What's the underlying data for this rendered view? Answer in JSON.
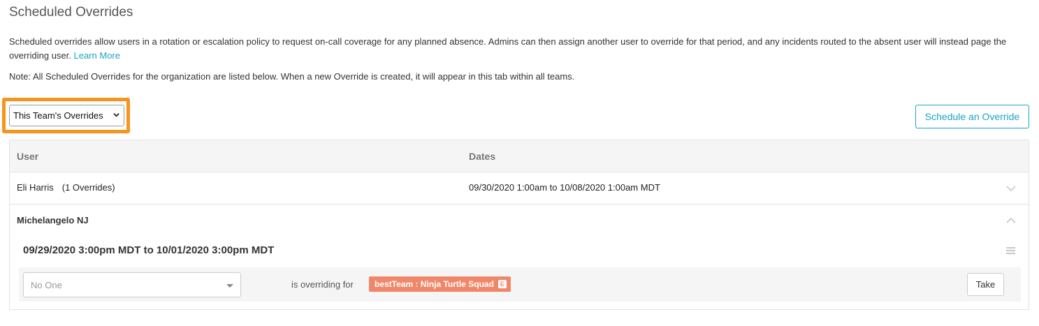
{
  "page": {
    "title": "Scheduled Overrides",
    "description": "Scheduled overrides allow users in a rotation or escalation policy to request on-call coverage for any planned absence. Admins can then assign another user to override for that period, and any incidents routed to the absent user will instead page the overriding user.",
    "learn_more": "Learn More",
    "note": "Note: All Scheduled Overrides for the organization are listed below. When a new Override is created, it will appear in this tab within all teams."
  },
  "filter": {
    "selected": "This Team's Overrides",
    "highlight_color": "#f7941e"
  },
  "schedule_button": "Schedule an Override",
  "table": {
    "headers": {
      "user": "User",
      "dates": "Dates"
    },
    "rows": [
      {
        "user": "Eli Harris",
        "count": "(1 Overrides)",
        "dates": "09/30/2020 1:00am to 10/08/2020 1:00am MDT",
        "expanded": false
      },
      {
        "user": "Michelangelo NJ",
        "expanded": true,
        "override": {
          "range": "09/29/2020 3:00pm MDT to 10/01/2020 3:00pm MDT",
          "assignee_placeholder": "No One",
          "overriding_text": "is overriding for",
          "team_badge": "bestTeam : Ninja Turtle Squad",
          "badge_flag": "E",
          "take_label": "Take"
        }
      }
    ]
  },
  "colors": {
    "accent": "#1aa3c8",
    "badge": "#f0876a"
  }
}
